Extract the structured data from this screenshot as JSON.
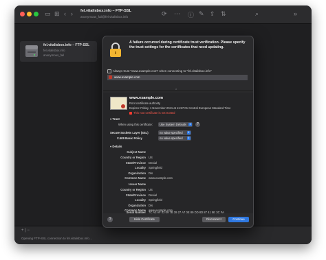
{
  "window": {
    "title": "fel.vitalisbox.info – FTP-SSL",
    "subtitle": "anonymous_fail@fel.vitalisbox.info"
  },
  "sidebar": {
    "card": {
      "title": "fel.vitalisbox.info – FTP-SSL",
      "subtitle": "fel.vitalisbox.info",
      "user": "anonymous_fail"
    }
  },
  "statusbar": {
    "text": "Opening FTP-SSL connection to fel.vitalisbox.info…",
    "plus_minus": "+ | −"
  },
  "dialog": {
    "message": "A failure occurred during certificate trust verification. Please specify the trust settings for the certificates that need updating.",
    "always_trust": "Always trust \"www.example.com\" when connecting to \"fel.vitalisbox.info\"",
    "list_item": "www.example.com",
    "cert": {
      "name": "www.example.com",
      "issuer_type": "Root certificate authority",
      "expires": "Expires: Friday, 1 November 2041 at 11:57:01 Central European Standard Time",
      "error": "This root certificate is not trusted"
    },
    "trust": {
      "section": "Trust",
      "when_using_label": "When using this certificate:",
      "when_using_value": "Use System Defaults",
      "ssl_label": "Secure Sockets Layer (SSL)",
      "ssl_value": "no value specified",
      "x509_label": "X.509 Basic Policy",
      "x509_value": "no value specified"
    },
    "details": {
      "section": "Details",
      "subject_header": "Subject Name",
      "subject": [
        {
          "key": "Country or Region",
          "value": "US"
        },
        {
          "key": "State/Province",
          "value": "Denial"
        },
        {
          "key": "Locality",
          "value": "Springfield"
        },
        {
          "key": "Organization",
          "value": "Dis"
        },
        {
          "key": "Common Name",
          "value": "www.example.com"
        }
      ],
      "issuer_header": "Issuer Name",
      "issuer": [
        {
          "key": "Country or Region",
          "value": "US"
        },
        {
          "key": "State/Province",
          "value": "Denial"
        },
        {
          "key": "Locality",
          "value": "Springfield"
        },
        {
          "key": "Organization",
          "value": "Dis"
        },
        {
          "key": "Common Name",
          "value": "www.example.com"
        }
      ],
      "serial_key": "Serial Number",
      "serial_value": "7C A3 AF 03 09 7B 39 27 A7 0E 89 DD 8D 87 41 5E 3C FA"
    },
    "buttons": {
      "help": "?",
      "hide_cert": "Hide Certificate",
      "disconnect": "Disconnect",
      "continue": "Continue"
    }
  }
}
